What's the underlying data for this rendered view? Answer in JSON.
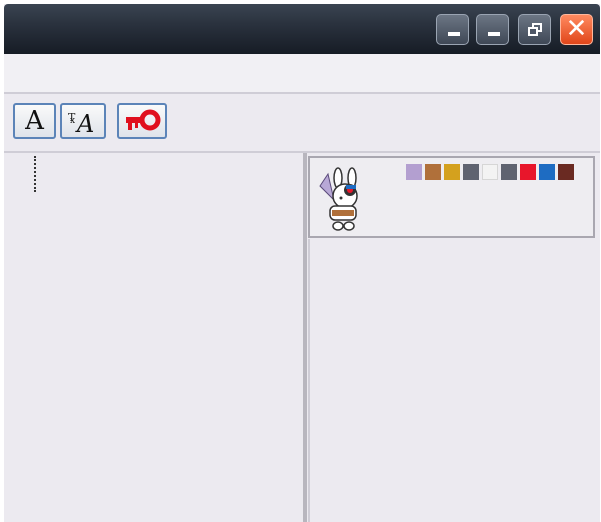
{
  "window": {
    "controls": {
      "minimize_label": "minimize",
      "minimize2_label": "minimize",
      "restore_label": "restore",
      "close_label": "close"
    }
  },
  "toolbar": {
    "tools": [
      {
        "icon": "text-tool-icon",
        "glyph": "A"
      },
      {
        "icon": "text-style-tool-icon",
        "glyph": "A"
      },
      {
        "icon": "key-tool-icon"
      }
    ]
  },
  "right_panel": {
    "character_card": {
      "icon": "rabbit-character-icon",
      "swatches": [
        "#B39FD0",
        "#B0703A",
        "#D4A11E",
        "#5F6370",
        "#F3F3F3",
        "#5F6370",
        "#E8162B",
        "#1E6CC2",
        "#6A2A22"
      ]
    }
  }
}
